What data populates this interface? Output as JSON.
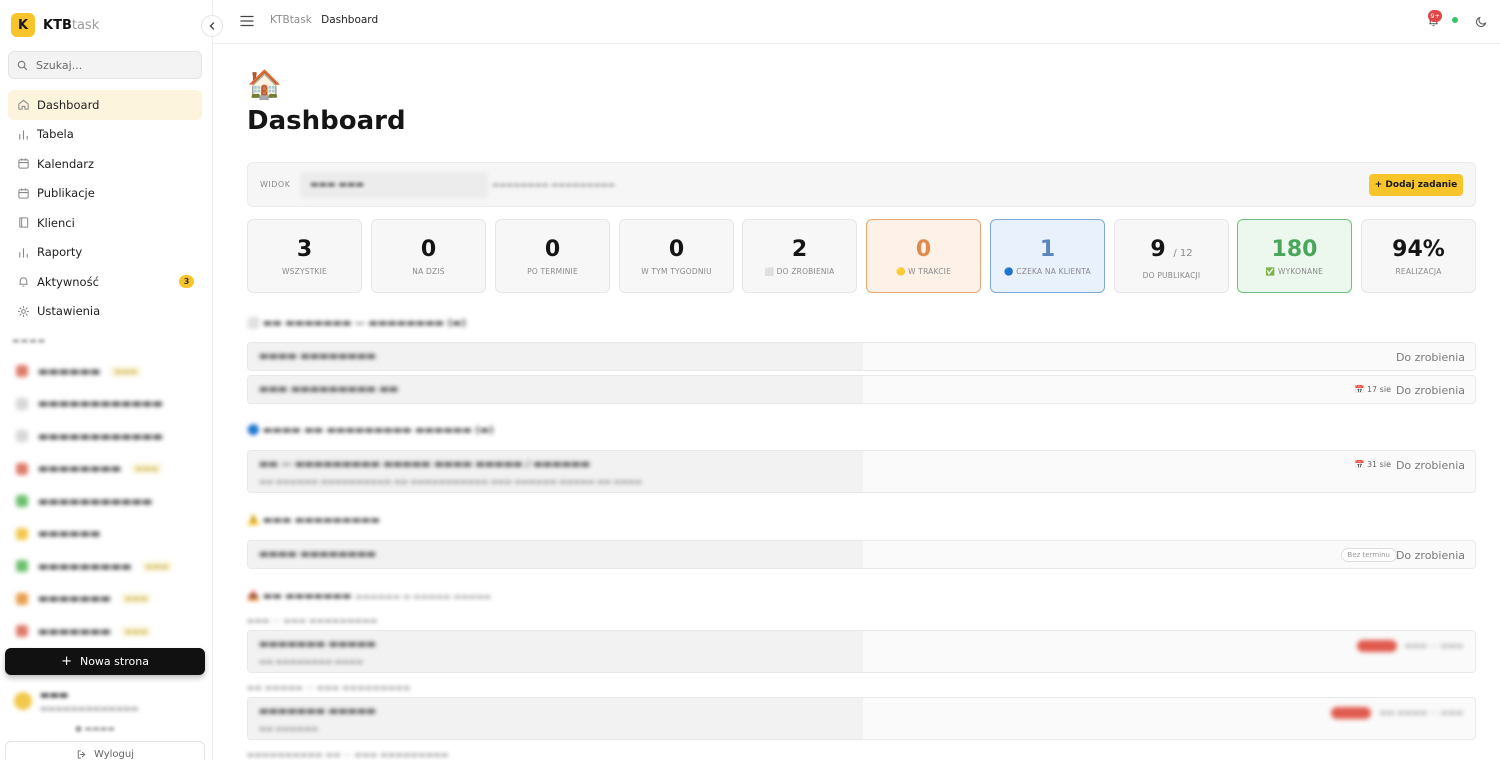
{
  "brand": {
    "logo_letter": "K",
    "name_bold": "KTB",
    "name_light": "task"
  },
  "search": {
    "placeholder": "Szukaj..."
  },
  "nav": [
    {
      "label": "Dashboard",
      "icon": "home-icon",
      "active": true
    },
    {
      "label": "Tabela",
      "icon": "bar-chart-icon"
    },
    {
      "label": "Kalendarz",
      "icon": "calendar-icon"
    },
    {
      "label": "Publikacje",
      "icon": "calendar-icon"
    },
    {
      "label": "Klienci",
      "icon": "book-icon"
    },
    {
      "label": "Raporty",
      "icon": "bar-chart-icon"
    },
    {
      "label": "Aktywność",
      "icon": "bell-icon",
      "badge": "3"
    },
    {
      "label": "Ustawienia",
      "icon": "gear-icon"
    }
  ],
  "sidebar_footer": {
    "new_page": "Nowa strona",
    "logout": "Wyloguj"
  },
  "topbar": {
    "crumb_root": "KTBtask",
    "crumb_current": "Dashboard",
    "notif_badge": "9+"
  },
  "page": {
    "emoji": "🏠",
    "title": "Dashboard"
  },
  "viewbar": {
    "label": "WIDOK",
    "add_task": "+ Dodaj zadanie"
  },
  "stats": [
    {
      "value": "3",
      "label": "WSZYSTKIE",
      "variant": "default"
    },
    {
      "value": "0",
      "label": "NA DZIŚ",
      "variant": "default"
    },
    {
      "value": "0",
      "label": "PO TERMINIE",
      "variant": "default"
    },
    {
      "value": "0",
      "label": "W TYM TYGODNIU",
      "variant": "default"
    },
    {
      "value": "2",
      "label": "⬜ DO ZROBIENIA",
      "variant": "default"
    },
    {
      "value": "0",
      "label": "🟡 W TRAKCIE",
      "variant": "orange"
    },
    {
      "value": "1",
      "label": "🔵 CZEKA NA KLIENTA",
      "variant": "blue"
    },
    {
      "value": "9",
      "total": "/ 12",
      "label": "DO PUBLIKACJI",
      "variant": "default"
    },
    {
      "value": "180",
      "label": "✅ WYKONANE",
      "variant": "green"
    },
    {
      "value": "94%",
      "label": "REALIZACJA",
      "variant": "default"
    }
  ],
  "tasks": [
    {
      "status": "Do zrobienia"
    },
    {
      "date": "📅 17 sie",
      "status": "Do zrobienia"
    },
    {
      "date": "📅 31 sie",
      "status": "Do zrobienia"
    },
    {
      "no_term": "Bez terminu",
      "status": "Do zrobienia"
    }
  ]
}
